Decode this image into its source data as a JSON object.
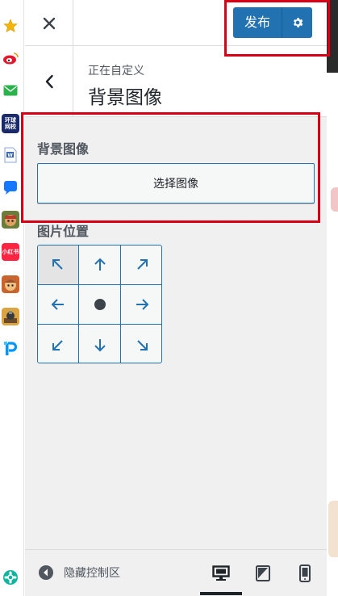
{
  "dock": {
    "icons": [
      "star-icon",
      "weibo-icon",
      "mail-icon",
      "news-app-icon",
      "word-doc-icon",
      "chat-app-icon",
      "game-app-icon",
      "xiaohongshu-app-icon",
      "game-app-2-icon",
      "game-app-3-icon",
      "pixiv-app-icon",
      "extension-app-icon"
    ],
    "news_app_text": "环球\n网校",
    "xhs_text": "小红书"
  },
  "topbar": {
    "close_label": "✕",
    "publish_label": "发布"
  },
  "section": {
    "subtitle": "正在自定义",
    "title": "背景图像"
  },
  "background_image": {
    "label": "背景图像",
    "select_button": "选择图像"
  },
  "image_position": {
    "label": "图片位置",
    "selected": "top-left",
    "cells": [
      "top-left",
      "top",
      "top-right",
      "left",
      "center",
      "right",
      "bottom-left",
      "bottom",
      "bottom-right"
    ]
  },
  "footer": {
    "collapse_label": "隐藏控制区",
    "devices": [
      "desktop",
      "tablet",
      "mobile"
    ],
    "active_device": "desktop"
  },
  "colors": {
    "accent": "#2271b1",
    "highlight": "#d90016",
    "panel_bg": "#f0f0f1"
  }
}
